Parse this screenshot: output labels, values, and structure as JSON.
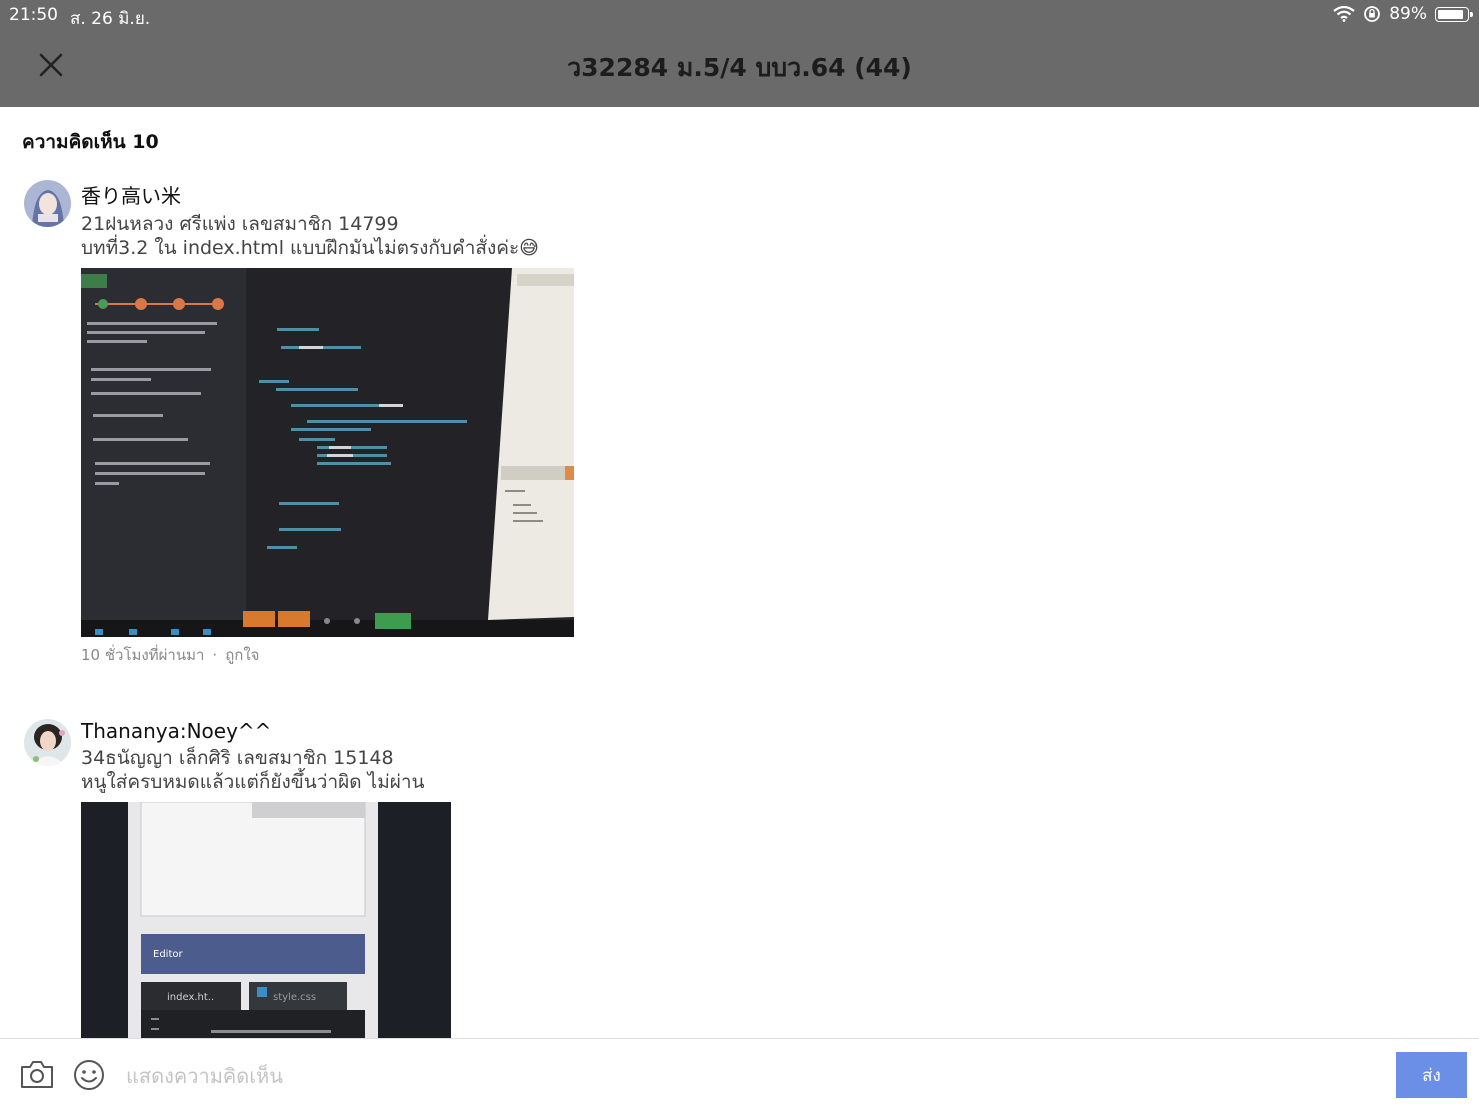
{
  "status_bar": {
    "time": "21:50",
    "date": "ส. 26 มิ.ย.",
    "battery": "89%",
    "battery_level": 0.89
  },
  "nav": {
    "title": "ว32284 ม.5/4 บบว.64 (44)"
  },
  "comments_header": "ความคิดเห็น 10",
  "comments": [
    {
      "author": "香り高い米",
      "line1": "21ฝนหลวง ศรีแพ่ง เลขสมาชิก 14799",
      "line2": "บทที่3.2 ใน index.html แบบฝึกมันไม่ตรงกับคำสั่งค่ะ😅",
      "time": "10 ชั่วโมงที่ผ่านมา",
      "like": "ถูกใจ"
    },
    {
      "author": "Thananya:Noey^^",
      "line1": "34ธนัญญา เล็กศิริ เลขสมาชิก 15148",
      "line2": "หนูใส่ครบหมดแล้วแต่ก็ยังขึ้นว่าผิด ไม่ผ่าน"
    }
  ],
  "composer": {
    "placeholder": "แสดงความคิดเห็น",
    "send_label": "ส่ง"
  },
  "icons": {
    "close": "close-icon",
    "camera": "camera-icon",
    "emoji": "emoji-icon",
    "wifi": "wifi-icon",
    "rotation_lock": "rotation-lock-icon",
    "battery": "battery-icon"
  },
  "colors": {
    "header_bg": "#6a6a6a",
    "send_button": "#6b8ee6"
  }
}
